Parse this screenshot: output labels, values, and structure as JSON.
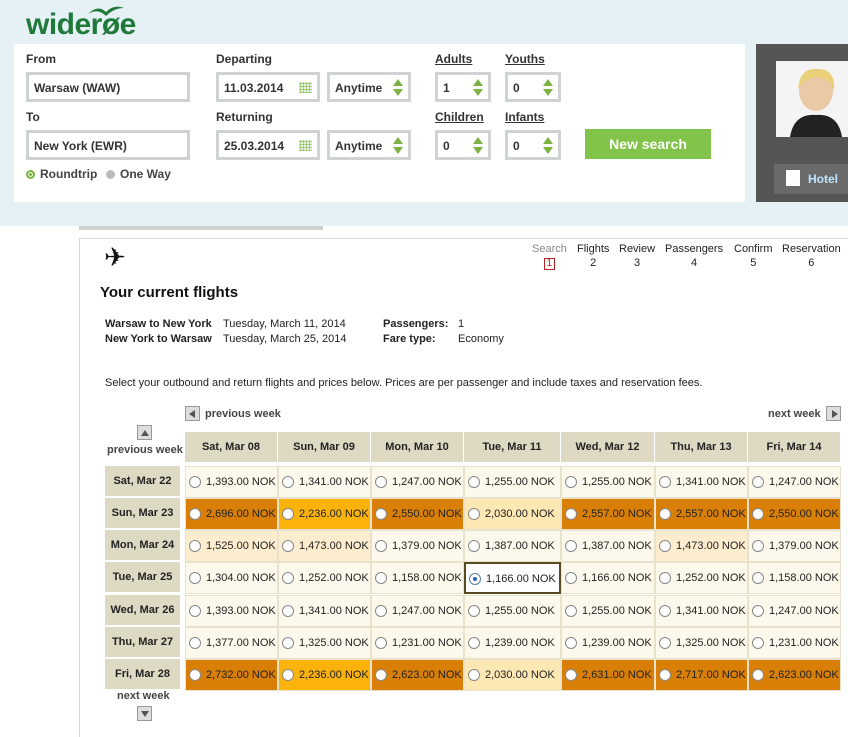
{
  "brand": {
    "logo_text": "widerøe",
    "accent": "#82c34a"
  },
  "search": {
    "from_label": "From",
    "from_value": "Warsaw (WAW)",
    "to_label": "To",
    "to_value": "New York (EWR)",
    "departing_label": "Departing",
    "departing_date": "11.03.2014",
    "departing_time": "Anytime",
    "returning_label": "Returning",
    "returning_date": "25.03.2014",
    "returning_time": "Anytime",
    "adults_label": "Adults",
    "adults_value": "1",
    "youths_label": "Youths",
    "youths_value": "0",
    "children_label": "Children",
    "children_value": "0",
    "infants_label": "Infants",
    "infants_value": "0",
    "trip_options": [
      "Roundtrip",
      "One Way"
    ],
    "trip_selected": "Roundtrip",
    "new_search_label": "New search"
  },
  "side": {
    "hotel_label": "Hotel"
  },
  "steps": [
    {
      "label": "Search",
      "num": "1"
    },
    {
      "label": "Flights",
      "num": "2"
    },
    {
      "label": "Review",
      "num": "3"
    },
    {
      "label": "Passengers",
      "num": "4"
    },
    {
      "label": "Confirm",
      "num": "5"
    },
    {
      "label": "Reservation",
      "num": "6"
    }
  ],
  "summary": {
    "title": "Your current flights",
    "out_route": "Warsaw to New York",
    "out_date": "Tuesday, March 11, 2014",
    "ret_route": "New York to Warsaw",
    "ret_date": "Tuesday, March 25, 2014",
    "passengers_label": "Passengers:",
    "passengers_value": "1",
    "fare_label": "Fare type:",
    "fare_value": "Economy",
    "note": "Select your outbound and return flights and prices below. Prices are per passenger and include taxes and reservation fees."
  },
  "nav": {
    "prev_week_top": "previous week",
    "next_week_top": "next week",
    "prev_week_side": "previous week",
    "next_week_side": "next week"
  },
  "grid": {
    "columns": [
      "Sat, Mar 08",
      "Sun, Mar 09",
      "Mon, Mar 10",
      "Tue, Mar 11",
      "Wed, Mar 12",
      "Thu, Mar 13",
      "Fri, Mar 14"
    ],
    "rows": [
      "Sat, Mar 22",
      "Sun, Mar 23",
      "Mon, Mar 24",
      "Tue, Mar 25",
      "Wed, Mar 26",
      "Thu, Mar 27",
      "Fri, Mar 28"
    ],
    "prices": [
      [
        "1,393.00 NOK",
        "1,341.00 NOK",
        "1,247.00 NOK",
        "1,255.00 NOK",
        "1,255.00 NOK",
        "1,341.00 NOK",
        "1,247.00 NOK"
      ],
      [
        "2,696.00 NOK",
        "2,236.00 NOK",
        "2,550.00 NOK",
        "2,030.00 NOK",
        "2,557.00 NOK",
        "2,557.00 NOK",
        "2,550.00 NOK"
      ],
      [
        "1,525.00 NOK",
        "1,473.00 NOK",
        "1,379.00 NOK",
        "1,387.00 NOK",
        "1,387.00 NOK",
        "1,473.00 NOK",
        "1,379.00 NOK"
      ],
      [
        "1,304.00 NOK",
        "1,252.00 NOK",
        "1,158.00 NOK",
        "1,166.00 NOK",
        "1,166.00 NOK",
        "1,252.00 NOK",
        "1,158.00 NOK"
      ],
      [
        "1,393.00 NOK",
        "1,341.00 NOK",
        "1,247.00 NOK",
        "1,255.00 NOK",
        "1,255.00 NOK",
        "1,341.00 NOK",
        "1,247.00 NOK"
      ],
      [
        "1,377.00 NOK",
        "1,325.00 NOK",
        "1,231.00 NOK",
        "1,239.00 NOK",
        "1,239.00 NOK",
        "1,325.00 NOK",
        "1,231.00 NOK"
      ],
      [
        "2,732.00 NOK",
        "2,236.00 NOK",
        "2,623.00 NOK",
        "2,030.00 NOK",
        "2,631.00 NOK",
        "2,717.00 NOK",
        "2,623.00 NOK"
      ]
    ],
    "shades": [
      [
        "#fdf8ec",
        "#fdf8ec",
        "#fdf8ec",
        "#fdf8ec",
        "#fdf8ec",
        "#fdf8ec",
        "#fdf8ec"
      ],
      [
        "#d97f06",
        "#fbb20a",
        "#d97f06",
        "#fde7b3",
        "#d97f06",
        "#d97f06",
        "#d97f06"
      ],
      [
        "#fdedcf",
        "#fdedcf",
        "#fdf8ec",
        "#fdf8ec",
        "#fdf8ec",
        "#fdedcf",
        "#fdf8ec"
      ],
      [
        "#fdf8ec",
        "#fdf8ec",
        "#fdf8ec",
        "#ffffff",
        "#fdf8ec",
        "#fdf8ec",
        "#fdf8ec"
      ],
      [
        "#fdf8ec",
        "#fdf8ec",
        "#fdf8ec",
        "#fdf8ec",
        "#fdf8ec",
        "#fdf8ec",
        "#fdf8ec"
      ],
      [
        "#fdf8ec",
        "#fdf8ec",
        "#fdf8ec",
        "#fdf8ec",
        "#fdf8ec",
        "#fdf8ec",
        "#fdf8ec"
      ],
      [
        "#d97f06",
        "#fbb20a",
        "#d97f06",
        "#fde7b3",
        "#d97f06",
        "#d97f06",
        "#d97f06"
      ]
    ],
    "selected": {
      "row": "Tue, Mar 25",
      "col": "Tue, Mar 11"
    }
  }
}
